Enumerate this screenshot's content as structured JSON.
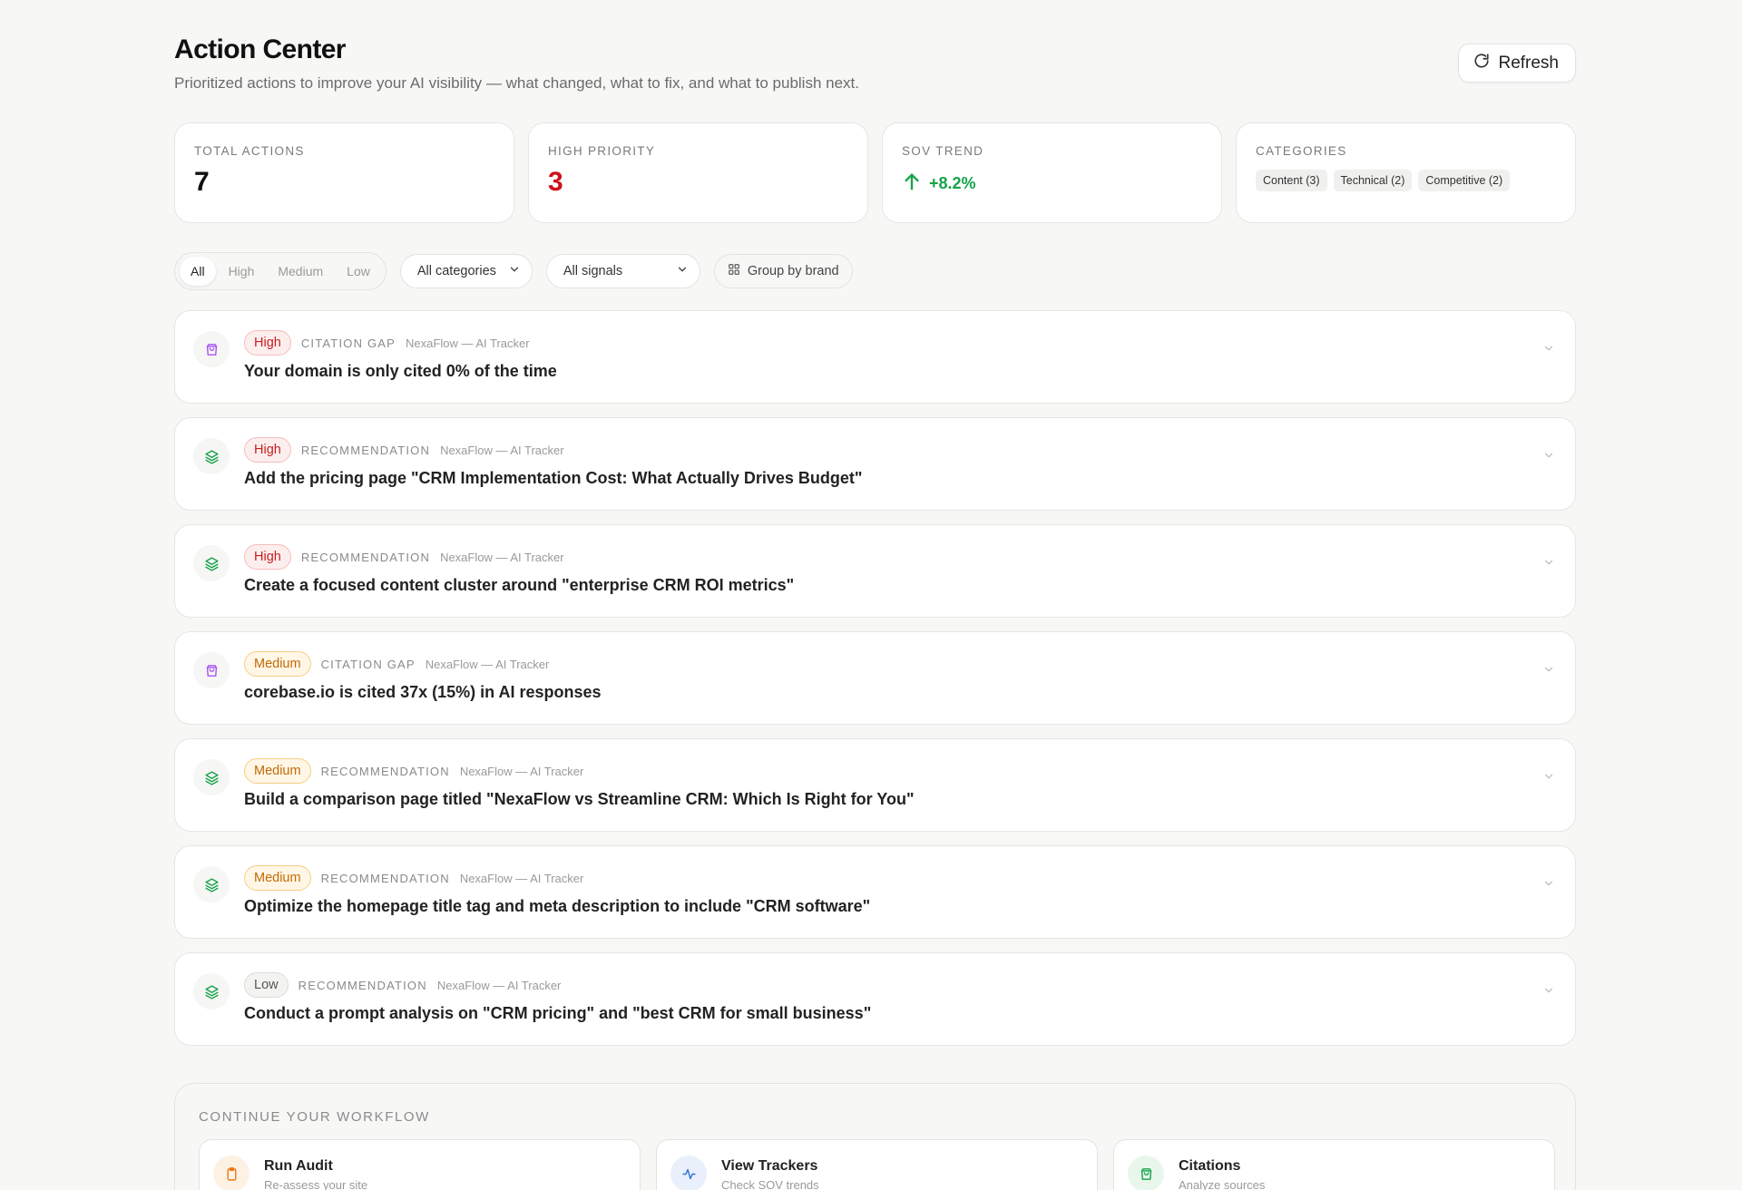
{
  "header": {
    "title": "Action Center",
    "subtitle": "Prioritized actions to improve your AI visibility — what changed, what to fix, and what to publish next.",
    "refresh_label": "Refresh"
  },
  "stats": {
    "total_actions": {
      "label": "TOTAL ACTIONS",
      "value": "7"
    },
    "high_priority": {
      "label": "HIGH PRIORITY",
      "value": "3"
    },
    "sov_trend": {
      "label": "SOV TREND",
      "value": "+8.2%",
      "icon": "arrow-up-icon",
      "color": "#16a34a"
    },
    "categories": {
      "label": "CATEGORIES",
      "chips": [
        "Content (3)",
        "Technical (2)",
        "Competitive (2)"
      ]
    }
  },
  "filters": {
    "priority_tabs": [
      "All",
      "High",
      "Medium",
      "Low"
    ],
    "active_tab": "All",
    "category_select": "All categories",
    "signal_select": "All signals",
    "group_by_label": "Group by brand"
  },
  "actions": [
    {
      "priority": "High",
      "signal": "CITATION GAP",
      "brand": "NexaFlow — AI Tracker",
      "title": "Your domain is only cited 0% of the time",
      "icon": "shopping-bag-icon"
    },
    {
      "priority": "High",
      "signal": "RECOMMENDATION",
      "brand": "NexaFlow — AI Tracker",
      "title": "Add the pricing page \"CRM Implementation Cost: What Actually Drives Budget\"",
      "icon": "layers-icon"
    },
    {
      "priority": "High",
      "signal": "RECOMMENDATION",
      "brand": "NexaFlow — AI Tracker",
      "title": "Create a focused content cluster around \"enterprise CRM ROI metrics\"",
      "icon": "layers-icon"
    },
    {
      "priority": "Medium",
      "signal": "CITATION GAP",
      "brand": "NexaFlow — AI Tracker",
      "title": "corebase.io is cited 37x (15%) in AI responses",
      "icon": "shopping-bag-icon"
    },
    {
      "priority": "Medium",
      "signal": "RECOMMENDATION",
      "brand": "NexaFlow — AI Tracker",
      "title": "Build a comparison page titled \"NexaFlow vs Streamline CRM: Which Is Right for You\"",
      "icon": "layers-icon"
    },
    {
      "priority": "Medium",
      "signal": "RECOMMENDATION",
      "brand": "NexaFlow — AI Tracker",
      "title": "Optimize the homepage title tag and meta description to include \"CRM software\"",
      "icon": "layers-icon"
    },
    {
      "priority": "Low",
      "signal": "RECOMMENDATION",
      "brand": "NexaFlow — AI Tracker",
      "title": "Conduct a prompt analysis on \"CRM pricing\" and \"best CRM for small business\"",
      "icon": "layers-icon"
    }
  ],
  "workflow": {
    "label": "CONTINUE YOUR WORKFLOW",
    "cards": [
      {
        "title": "Run Audit",
        "subtitle": "Re-assess your site",
        "icon": "clipboard-icon",
        "color": "#ea7a17",
        "bg": "#fdf1e4"
      },
      {
        "title": "View Trackers",
        "subtitle": "Check SOV trends",
        "icon": "activity-icon",
        "color": "#2f6fd8",
        "bg": "#e9f0fc"
      },
      {
        "title": "Citations",
        "subtitle": "Analyze sources",
        "icon": "shopping-bag-icon",
        "color": "#16a34a",
        "bg": "#e8f6ec"
      }
    ]
  },
  "colors": {
    "high": "#c81e1e",
    "medium": "#c26a05",
    "low": "#555555",
    "citation_icon": "#a855f7",
    "recommendation_icon": "#16a34a"
  }
}
